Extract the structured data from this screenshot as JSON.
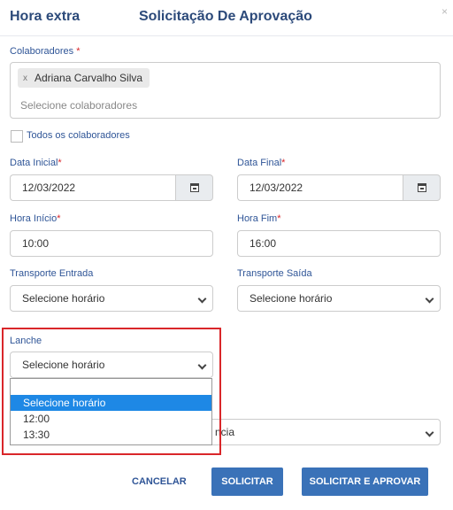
{
  "header": {
    "title_left": "Hora extra",
    "title_center": "Solicitação De Aprovação",
    "close": "×"
  },
  "collaborators": {
    "label": "Colaboradores",
    "required_mark": "*",
    "chip_remove": "x",
    "selected": [
      "Adriana Carvalho Silva"
    ],
    "placeholder": "Selecione colaboradores"
  },
  "all_collaborators": {
    "label": "Todos os colaboradores",
    "checked": false
  },
  "dates": {
    "start_label": "Data Inicial",
    "start_value": "12/03/2022",
    "end_label": "Data Final",
    "end_value": "12/03/2022",
    "required_mark": "*"
  },
  "hours": {
    "start_label": "Hora Início",
    "start_value": "10:00",
    "end_label": "Hora Fim",
    "end_value": "16:00",
    "required_mark": "*"
  },
  "transport": {
    "in_label": "Transporte Entrada",
    "in_value": "Selecione horário",
    "out_label": "Transporte Saída",
    "out_value": "Selecione horário"
  },
  "snack": {
    "label": "Lanche",
    "value": "Selecione horário",
    "options": [
      "",
      "Selecione horário",
      "12:00",
      "13:30"
    ],
    "highlighted_index": 1
  },
  "hidden_select_partial_text": "ncia",
  "buttons": {
    "cancel": "CANCELAR",
    "request": "SOLICITAR",
    "request_approve": "SOLICITAR E APROVAR"
  },
  "colors": {
    "primary": "#3a72b8",
    "label": "#2f5597",
    "highlight": "#1e88e5",
    "required": "#d9262a",
    "annotation_box": "#d9262a"
  }
}
